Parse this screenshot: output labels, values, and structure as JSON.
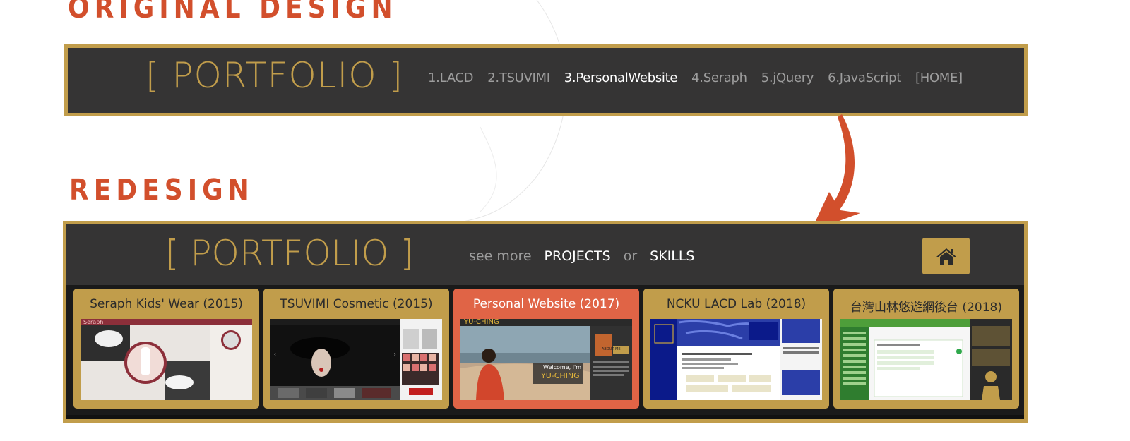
{
  "headings": {
    "original": "ORIGINAL DESIGN",
    "redesign": "REDESIGN"
  },
  "original_bar": {
    "logo": "[ PORTFOLIO ]",
    "nav": [
      {
        "label": "1.LACD",
        "active": false
      },
      {
        "label": "2.TSUVIMI",
        "active": false
      },
      {
        "label": "3.PersonalWebsite",
        "active": true
      },
      {
        "label": "4.Seraph",
        "active": false
      },
      {
        "label": "5.jQuery",
        "active": false
      },
      {
        "label": "6.JavaScript",
        "active": false
      },
      {
        "label": "[HOME]",
        "active": false
      }
    ]
  },
  "redesign_bar": {
    "logo": "[ PORTFOLIO ]",
    "see_more": "see more",
    "projects": "PROJECTS",
    "or": "or",
    "skills": "SKILLS",
    "home_icon": "home-icon"
  },
  "cards": [
    {
      "title": "Seraph Kids' Wear (2015)",
      "active": false
    },
    {
      "title": "TSUVIMI Cosmetic (2015)",
      "active": false
    },
    {
      "title": "Personal Website (2017)",
      "active": true
    },
    {
      "title": "NCKU LACD Lab (2018)",
      "active": false
    },
    {
      "title": "台灣山林悠遊網後台 (2018)",
      "active": false
    }
  ],
  "thumb_text": {
    "seraph": "Seraph",
    "personal_brand": "YU-CHING",
    "personal_welcome": "Welcome, I'm",
    "personal_about": "ABOUT ME"
  },
  "colors": {
    "accent_gold": "#c19d4b",
    "accent_red": "#d24f2c",
    "bar_dark": "#353434",
    "card_active": "#e06446"
  }
}
